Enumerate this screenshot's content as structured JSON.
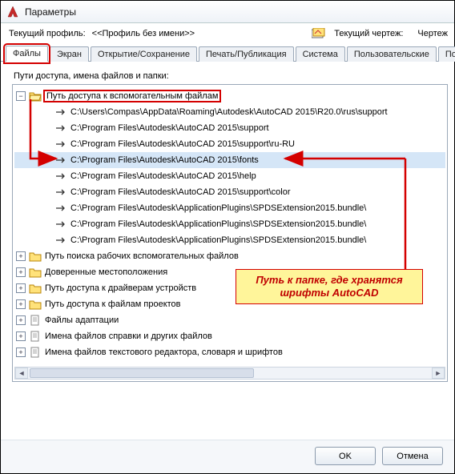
{
  "window": {
    "title": "Параметры"
  },
  "profile": {
    "label": "Текущий профиль:",
    "value": "<<Профиль без имени>>",
    "drawing_label": "Текущий чертеж:",
    "drawing_value": "Чертеж"
  },
  "tabs": [
    {
      "label": "Файлы",
      "active": true
    },
    {
      "label": "Экран"
    },
    {
      "label": "Открытие/Сохранение"
    },
    {
      "label": "Печать/Публикация"
    },
    {
      "label": "Система"
    },
    {
      "label": "Пользовательские"
    },
    {
      "label": "Построе"
    }
  ],
  "section_label": "Пути доступа, имена файлов и папки:",
  "tree": {
    "root": {
      "label": "Путь доступа к вспомогательным файлам",
      "expanded": true
    },
    "paths": [
      "C:\\Users\\Compas\\AppData\\Roaming\\Autodesk\\AutoCAD 2015\\R20.0\\rus\\support",
      "C:\\Program Files\\Autodesk\\AutoCAD 2015\\support",
      "C:\\Program Files\\Autodesk\\AutoCAD 2015\\support\\ru-RU",
      "C:\\Program Files\\Autodesk\\AutoCAD 2015\\fonts",
      "C:\\Program Files\\Autodesk\\AutoCAD 2015\\help",
      "C:\\Program Files\\Autodesk\\AutoCAD 2015\\support\\color",
      "C:\\Program Files\\Autodesk\\ApplicationPlugins\\SPDSExtension2015.bundle\\",
      "C:\\Program Files\\Autodesk\\ApplicationPlugins\\SPDSExtension2015.bundle\\",
      "C:\\Program Files\\Autodesk\\ApplicationPlugins\\SPDSExtension2015.bundle\\"
    ],
    "selected_index": 3,
    "siblings": [
      "Путь поиска рабочих вспомогательных файлов",
      "Доверенные местоположения",
      "Путь доступа к драйверам устройств",
      "Путь доступа к файлам проектов",
      "Файлы адаптации",
      "Имена файлов справки и других файлов",
      "Имена файлов текстового редактора, словаря и шрифтов"
    ]
  },
  "callout": "Путь к папке, где хранятся шрифты AutoCAD",
  "buttons": {
    "ok": "OK",
    "cancel": "Отмена"
  },
  "icons": {
    "expand_plus": "+",
    "expand_minus": "−",
    "scroll_left": "◄",
    "scroll_right": "►"
  }
}
